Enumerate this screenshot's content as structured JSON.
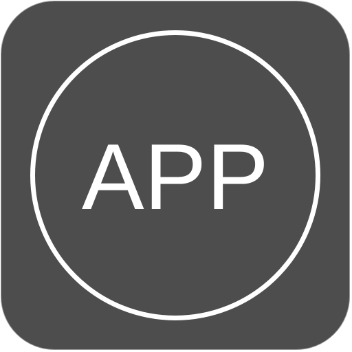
{
  "app_icon": {
    "label": "APP",
    "colors": {
      "background": "#4d4d4d",
      "foreground": "#ffffff",
      "border": "#9a9a9a"
    },
    "icon_name": "app-placeholder-icon"
  }
}
